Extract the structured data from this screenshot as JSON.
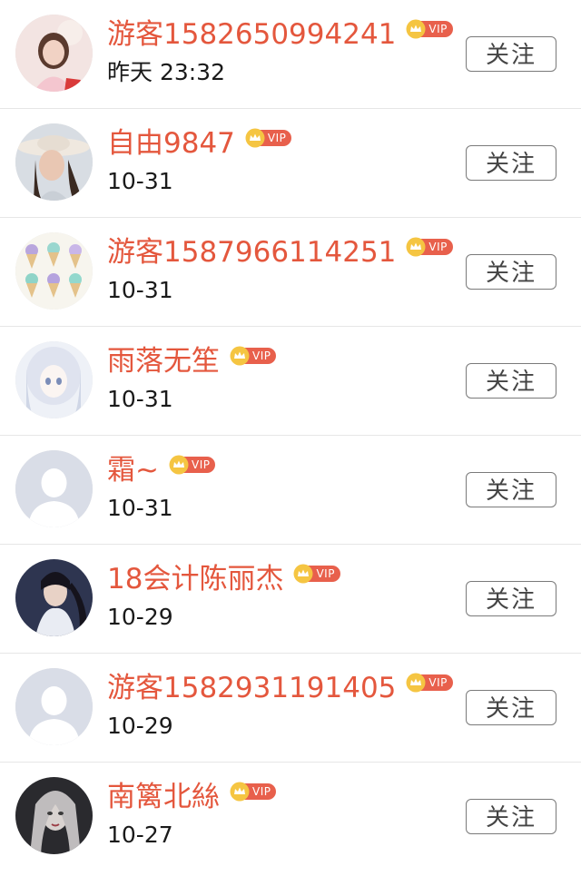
{
  "vip_label": "VIP",
  "colors": {
    "name": "#e4573d",
    "vip_badge": "#e8604c",
    "crown": "#f5c542",
    "divider": "#e6e6e6"
  },
  "users": [
    {
      "name": "游客1582650994241",
      "date": "昨天 23:32",
      "follow_label": "关注",
      "avatar": "girl-photo-avatar"
    },
    {
      "name": "自由9847",
      "date": "10-31",
      "follow_label": "关注",
      "avatar": "woman-hat-avatar"
    },
    {
      "name": "游客1587966114251",
      "date": "10-31",
      "follow_label": "关注",
      "avatar": "ice-cream-avatar"
    },
    {
      "name": "雨落无笙",
      "date": "10-31",
      "follow_label": "关注",
      "avatar": "anime-girl-avatar"
    },
    {
      "name": "霜~",
      "date": "10-31",
      "follow_label": "关注",
      "avatar": "default-avatar"
    },
    {
      "name": "18会计陈丽杰",
      "date": "10-29",
      "follow_label": "关注",
      "avatar": "costume-man-avatar"
    },
    {
      "name": "游客1582931191405",
      "date": "10-29",
      "follow_label": "关注",
      "avatar": "default-avatar"
    },
    {
      "name": "南篱北絲",
      "date": "10-27",
      "follow_label": "关注",
      "avatar": "dark-portrait-avatar"
    }
  ]
}
